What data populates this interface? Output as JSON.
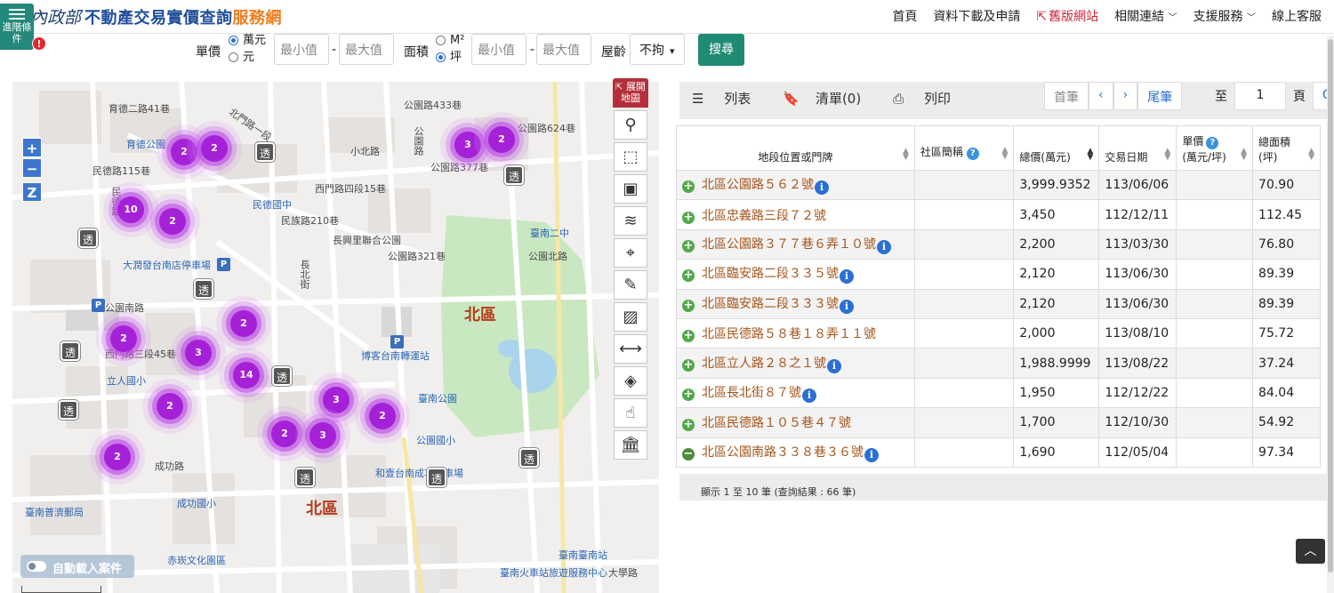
{
  "header": {
    "ministry": "內政部",
    "title_main": "不動產交易實價查詢",
    "title_accent": "服務網",
    "nav": [
      "首頁",
      "資料下載及申請",
      "舊版網站",
      "相關連結",
      "支援服務",
      "線上客服"
    ]
  },
  "filters": {
    "advanced_label": "進階條件",
    "alert_badge": "!",
    "unit_price_label": "單價",
    "unit_price_options": [
      "萬元",
      "元"
    ],
    "area_label": "面積",
    "area_options": [
      "M²",
      "坪"
    ],
    "min_placeholder": "最小值",
    "max_placeholder": "最大值",
    "dash": "-",
    "age_label": "屋齡",
    "age_value": "不拘",
    "search_button": "搜尋"
  },
  "map": {
    "expand_label": "展開地圖",
    "zoom_in": "+",
    "zoom_out": "−",
    "zoom_z": "Z",
    "auto_load_label": "自動載入案件",
    "district_label": "北區",
    "tools": [
      "route-icon",
      "select-rect-icon",
      "select-area-icon",
      "layers-icon",
      "locate-icon",
      "draw-icon",
      "hatch-icon",
      "measure-icon",
      "eraser-icon",
      "pointer-icon",
      "landmark-icon"
    ],
    "clusters": [
      "2",
      "2",
      "3",
      "2",
      "10",
      "2",
      "2",
      "2",
      "3",
      "14",
      "2",
      "3",
      "2",
      "2",
      "3",
      "2"
    ],
    "transit_badge": "透",
    "parking_badge": "P",
    "place_labels": [
      "育德二路41巷",
      "育德公園",
      "民德路115巷",
      "民德路",
      "民德國中",
      "北門路一段",
      "長興里聯合公園",
      "公園路",
      "公園北路",
      "公園路433巷",
      "公園路624巷",
      "公園路377巷",
      "公園路321巷",
      "小北路",
      "西門路四段15巷",
      "民族路210巷",
      "長北街",
      "臺南二中",
      "大潤發台南店停車場",
      "公園南路",
      "博客台南轉運站",
      "臺南公園",
      "西門路三段45巷",
      "立人國小",
      "公園國小",
      "和壹台南成功停車場",
      "成功國小",
      "成功路",
      "臺南普濟郵局",
      "赤崁文化園區",
      "臺南火車站旅遊服務中心",
      "臺南臺南站",
      "大學路",
      "北區"
    ]
  },
  "results": {
    "tabs": [
      "列表",
      "清單(0)",
      "列印"
    ],
    "pager": [
      "首筆",
      "‹",
      "›",
      "尾筆"
    ],
    "goto_label": "至",
    "page_value": "1",
    "page_unit": "頁",
    "go_label": "GO",
    "columns": [
      "地段位置或門牌",
      "社區簡稱",
      "總價(萬元)",
      "交易日期",
      "單價(萬元/坪)",
      "總面積(坪)"
    ],
    "rows": [
      {
        "address": "北區公園路５６２號",
        "community": "",
        "total": "3,999.9352",
        "date": "113/06/06",
        "unit": "",
        "area": "70.90",
        "info": true,
        "expanded": false
      },
      {
        "address": "北區忠義路三段７２號",
        "community": "",
        "total": "3,450",
        "date": "112/12/11",
        "unit": "",
        "area": "112.45",
        "info": false,
        "expanded": false
      },
      {
        "address": "北區公園路３７７巷６弄１０號",
        "community": "",
        "total": "2,200",
        "date": "113/03/30",
        "unit": "",
        "area": "76.80",
        "info": true,
        "expanded": false
      },
      {
        "address": "北區臨安路二段３３５號",
        "community": "",
        "total": "2,120",
        "date": "113/06/30",
        "unit": "",
        "area": "89.39",
        "info": true,
        "expanded": false
      },
      {
        "address": "北區臨安路二段３３３號",
        "community": "",
        "total": "2,120",
        "date": "113/06/30",
        "unit": "",
        "area": "89.39",
        "info": true,
        "expanded": false
      },
      {
        "address": "北區民德路５８巷１８弄１１號",
        "community": "",
        "total": "2,000",
        "date": "113/08/10",
        "unit": "",
        "area": "75.72",
        "info": false,
        "expanded": false
      },
      {
        "address": "北區立人路２８之１號",
        "community": "",
        "total": "1,988.9999",
        "date": "113/08/22",
        "unit": "",
        "area": "37.24",
        "info": true,
        "expanded": false
      },
      {
        "address": "北區長北街８７號",
        "community": "",
        "total": "1,950",
        "date": "112/12/22",
        "unit": "",
        "area": "84.04",
        "info": true,
        "expanded": false
      },
      {
        "address": "北區民德路１０５巷４７號",
        "community": "",
        "total": "1,700",
        "date": "112/10/30",
        "unit": "",
        "area": "54.92",
        "info": false,
        "expanded": false
      },
      {
        "address": "北區公園南路３３８巷３６號",
        "community": "",
        "total": "1,690",
        "date": "112/05/04",
        "unit": "",
        "area": "97.34",
        "info": true,
        "expanded": true
      }
    ],
    "summary": "顯示 1 至 10 筆 (查詢結果 : 66 筆)"
  },
  "scroll_top_label": "︿"
}
